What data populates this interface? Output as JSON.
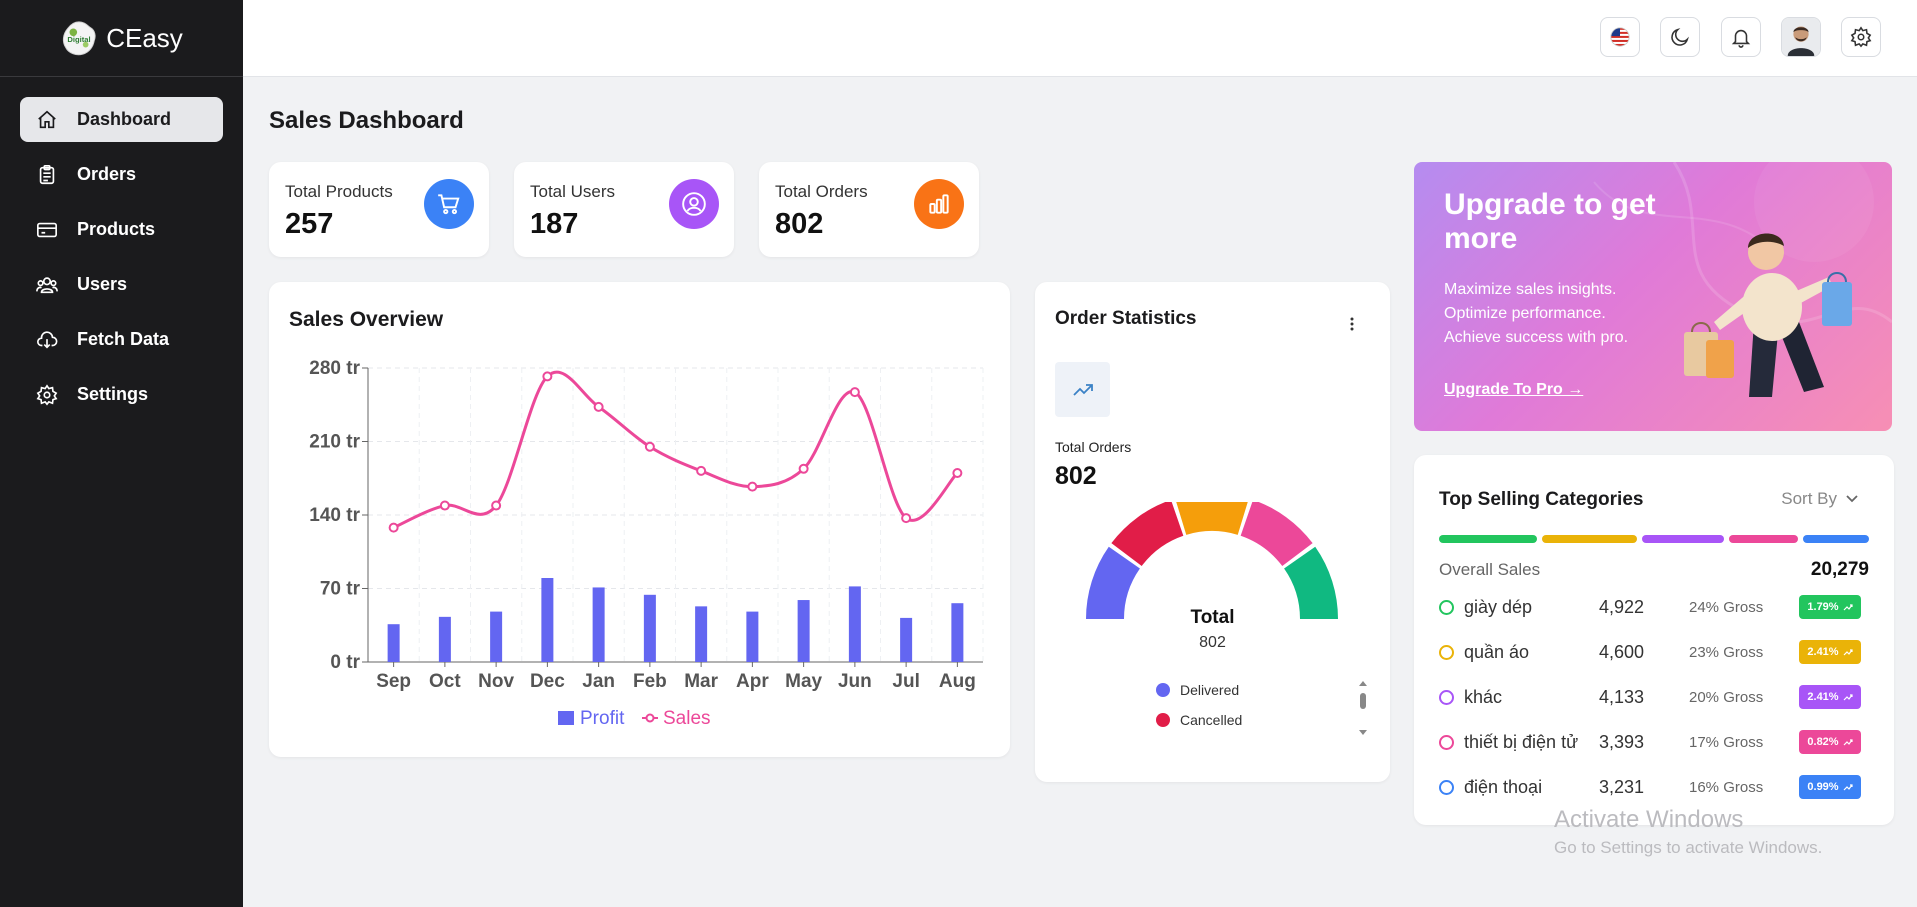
{
  "brand": {
    "name": "CEasy",
    "logo_text": "Digital"
  },
  "sidebar": {
    "items": [
      {
        "label": "Dashboard",
        "icon": "home-icon",
        "active": true
      },
      {
        "label": "Orders",
        "icon": "clipboard-icon"
      },
      {
        "label": "Products",
        "icon": "card-icon"
      },
      {
        "label": "Users",
        "icon": "users-icon"
      },
      {
        "label": "Fetch Data",
        "icon": "cloud-download-icon"
      },
      {
        "label": "Settings",
        "icon": "gear-icon"
      }
    ]
  },
  "header": {
    "icons": [
      "us-flag-icon",
      "moon-icon",
      "bell-icon",
      "avatar",
      "gear-icon"
    ]
  },
  "page": {
    "title": "Sales Dashboard"
  },
  "stats": [
    {
      "label": "Total Products",
      "value": "257",
      "icon": "cart-icon",
      "color": "#3b82f6"
    },
    {
      "label": "Total Users",
      "value": "187",
      "icon": "user-circle-icon",
      "color": "#a855f7"
    },
    {
      "label": "Total Orders",
      "value": "802",
      "icon": "bar-chart-icon",
      "color": "#f97316"
    }
  ],
  "sales_overview": {
    "title": "Sales Overview"
  },
  "chart_data": {
    "type": "bar",
    "categories": [
      "Sep",
      "Oct",
      "Nov",
      "Dec",
      "Jan",
      "Feb",
      "Mar",
      "Apr",
      "May",
      "Jun",
      "Jul",
      "Aug"
    ],
    "series": [
      {
        "name": "Profit",
        "type": "bar",
        "color": "#6366f1",
        "values": [
          36,
          43,
          48,
          80,
          71,
          64,
          53,
          48,
          59,
          72,
          42,
          56
        ]
      },
      {
        "name": "Sales",
        "type": "line",
        "color": "#ec4899",
        "values": [
          128,
          149,
          149,
          272,
          243,
          205,
          182,
          167,
          184,
          257,
          137,
          180
        ]
      }
    ],
    "yticks": [
      "0 tr",
      "70 tr",
      "140 tr",
      "210 tr",
      "280 tr"
    ],
    "ylim": [
      0,
      280
    ],
    "grid": true,
    "legend": "bottom"
  },
  "order_statistics": {
    "title": "Order Statistics",
    "menu_icon": "more-vertical-icon",
    "trend_icon": "trending-up-icon",
    "total_label": "Total Orders",
    "total_value": "802",
    "gauge_label": "Total",
    "gauge_value": "802",
    "gauge_colors": [
      "#6366f1",
      "#e11d48",
      "#f59e0b",
      "#ec4899",
      "#10b981"
    ],
    "legend": [
      {
        "label": "Delivered",
        "color": "#6366f1"
      },
      {
        "label": "Cancelled",
        "color": "#e11d48"
      }
    ]
  },
  "promo": {
    "title": "Upgrade to get more",
    "lines": [
      "Maximize sales insights.",
      "Optimize performance.",
      "Achieve success with pro."
    ],
    "link": "Upgrade To Pro →"
  },
  "top_selling": {
    "title": "Top Selling Categories",
    "sort_label": "Sort By",
    "overall_label": "Overall Sales",
    "overall_value": "20,279",
    "bar_colors": [
      "#22c55e",
      "#eab308",
      "#a855f7",
      "#ec4899",
      "#3b82f6"
    ],
    "categories": [
      {
        "name": "giày dép",
        "count": "4,922",
        "gross": "24% Gross",
        "badge": "1.79%",
        "color": "#22c55e"
      },
      {
        "name": "quần áo",
        "count": "4,600",
        "gross": "23% Gross",
        "badge": "2.41%",
        "color": "#eab308"
      },
      {
        "name": "khác",
        "count": "4,133",
        "gross": "20% Gross",
        "badge": "2.41%",
        "color": "#a855f7"
      },
      {
        "name": "thiết bị điện tử",
        "count": "3,393",
        "gross": "17% Gross",
        "badge": "0.82%",
        "color": "#ec4899"
      },
      {
        "name": "điện thoại",
        "count": "3,231",
        "gross": "16% Gross",
        "badge": "0.99%",
        "color": "#3b82f6"
      }
    ]
  },
  "watermark": {
    "line1": "Activate Windows",
    "line2": "Go to Settings to activate Windows."
  }
}
